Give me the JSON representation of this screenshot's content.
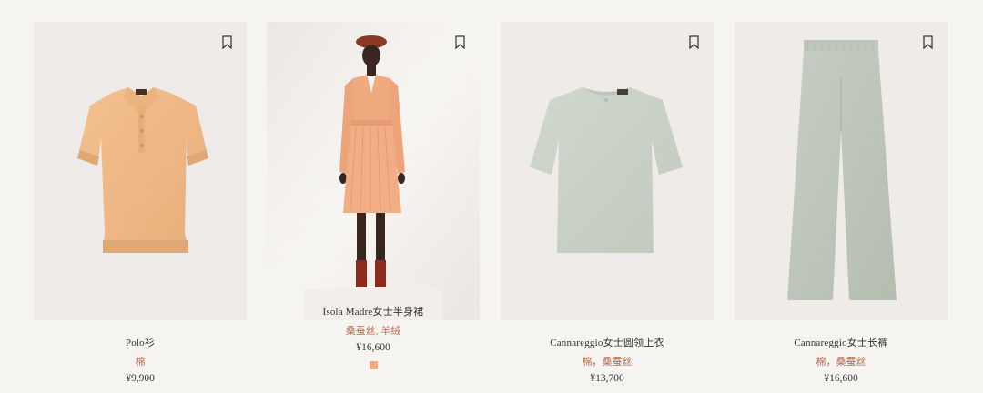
{
  "products": [
    {
      "name": "Polo衫",
      "material": "棉",
      "price": "¥9,900",
      "image_icon": "polo-shirt-icon",
      "color": "#efb98a"
    },
    {
      "name": "Isola Madre女士半身裙",
      "material": "桑蚕丝, 羊绒",
      "price": "¥16,600",
      "image_icon": "model-dress-icon",
      "color": "#f2b58e",
      "swatch_color": "#f2a987"
    },
    {
      "name": "Cannareggio女士圆领上衣",
      "material": "棉，桑蚕丝",
      "price": "¥13,700",
      "image_icon": "tshirt-icon",
      "color": "#c9d0c5"
    },
    {
      "name": "Cannareggio女士长裤",
      "material": "棉，桑蚕丝",
      "price": "¥16,600",
      "image_icon": "trousers-icon",
      "color": "#bcc3b8"
    }
  ]
}
